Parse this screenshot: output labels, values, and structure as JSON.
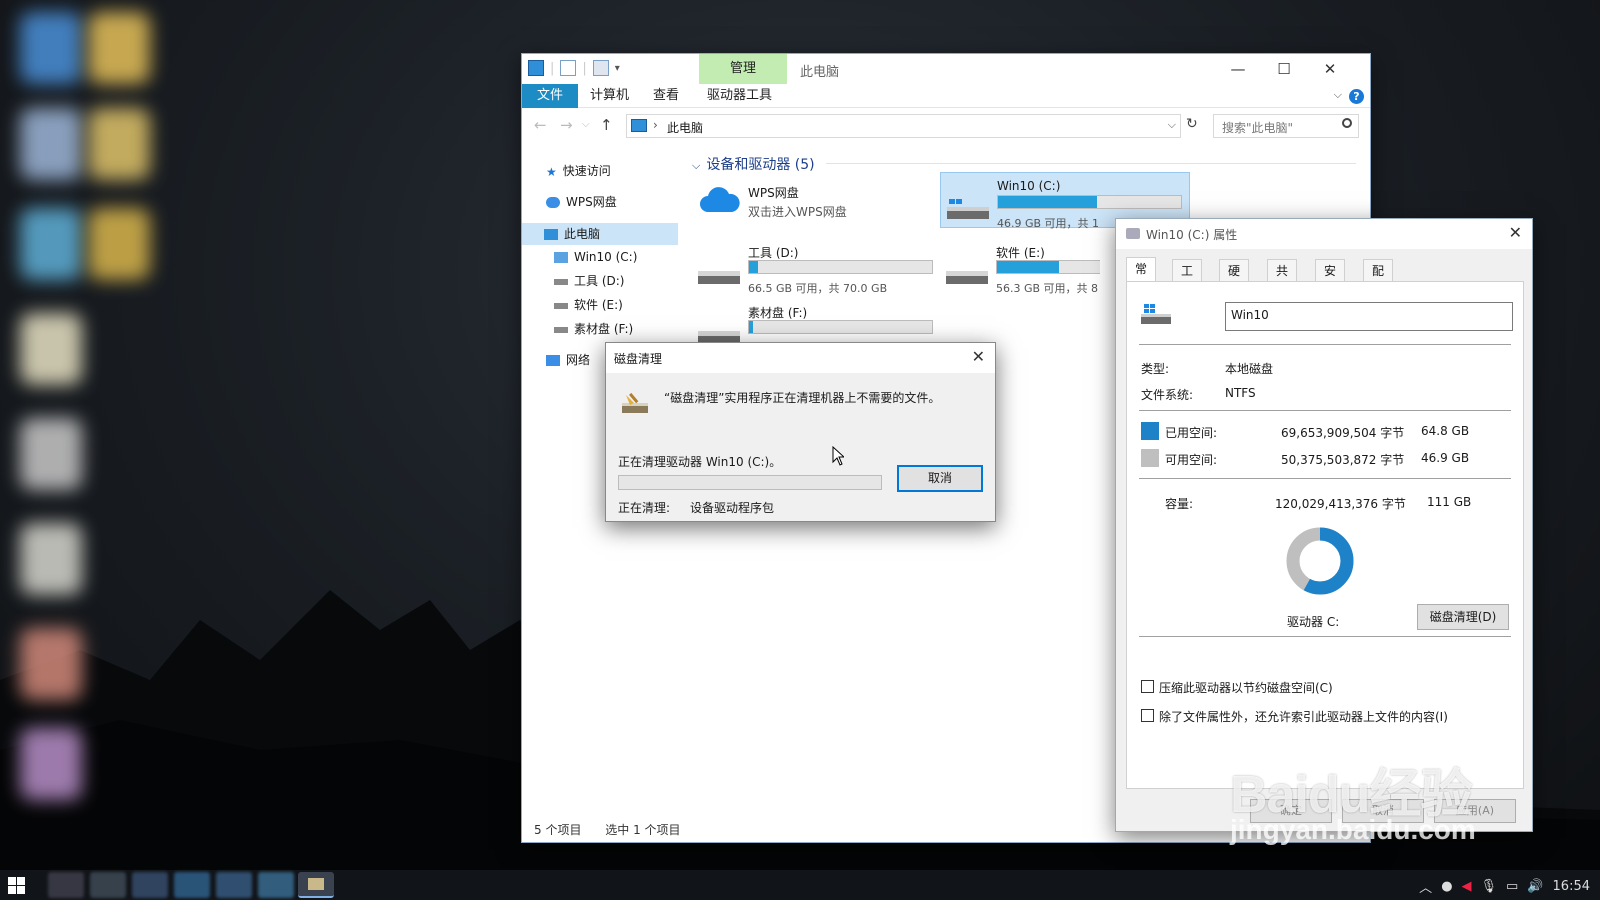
{
  "explorer": {
    "title": "此电脑",
    "context_tab": "管理",
    "ribbon_tabs": [
      "文件",
      "计算机",
      "查看",
      "驱动器工具"
    ],
    "address_path": "此电脑",
    "search_placeholder": "搜索\"此电脑\"",
    "nav": {
      "quick_access": "快速访问",
      "wps": "WPS网盘",
      "this_pc": "此电脑",
      "drive_c": "Win10 (C:)",
      "drive_d": "工具 (D:)",
      "drive_e": "软件 (E:)",
      "drive_f": "素材盘 (F:)",
      "network": "网络"
    },
    "group_title": "设备和驱动器 (5)",
    "tiles": {
      "wps_name": "WPS网盘",
      "wps_sub": "双击进入WPS网盘",
      "c_name": "Win10 (C:)",
      "c_sub": "46.9 GB 可用，共 1",
      "c_used": 0.54,
      "d_name": "工具 (D:)",
      "d_sub": "66.5 GB 可用，共 70.0 GB",
      "d_used": 0.05,
      "e_name": "软件 (E:)",
      "e_sub": "56.3 GB 可用，共 8",
      "e_used": 0.34,
      "f_name": "素材盘 (F:)",
      "f_used": 0.02
    },
    "status": {
      "items": "5 个项目",
      "selected": "选中 1 个项目"
    }
  },
  "cleanup": {
    "title": "磁盘清理",
    "message": "“磁盘清理”实用程序正在清理机器上不需要的文件。",
    "drive_line": "正在清理驱动器 Win10 (C:)。",
    "cancel": "取消",
    "cleaning_label": "正在清理:",
    "cleaning_value": "设备驱动程序包",
    "progress": 0
  },
  "props": {
    "title": "Win10 (C:) 属性",
    "tabs": [
      "常规",
      "工具",
      "硬件",
      "共享",
      "安全",
      "配额"
    ],
    "volume_name": "Win10",
    "type_label": "类型:",
    "type_value": "本地磁盘",
    "fs_label": "文件系统:",
    "fs_value": "NTFS",
    "used_label": "已用空间:",
    "used_bytes": "69,653,909,504 字节",
    "used_gb": "64.8 GB",
    "free_label": "可用空间:",
    "free_bytes": "50,375,503,872 字节",
    "free_gb": "46.9 GB",
    "cap_label": "容量:",
    "cap_bytes": "120,029,413,376 字节",
    "cap_gb": "111 GB",
    "used_fraction": 0.58,
    "drive_label": "驱动器 C:",
    "cleanup_button": "磁盘清理(D)",
    "compress_option": "压缩此驱动器以节约磁盘空间(C)",
    "index_option": "除了文件属性外，还允许索引此驱动器上文件的内容(I)",
    "ok": "确定",
    "cancel": "取消",
    "apply": "应用(A)",
    "used_color": "#1e82c8",
    "free_color": "#bfbfbf"
  },
  "taskbar": {
    "time": "16:54"
  },
  "watermark": {
    "brand": "Baidu经验",
    "url": "jingyan.baidu.com"
  }
}
